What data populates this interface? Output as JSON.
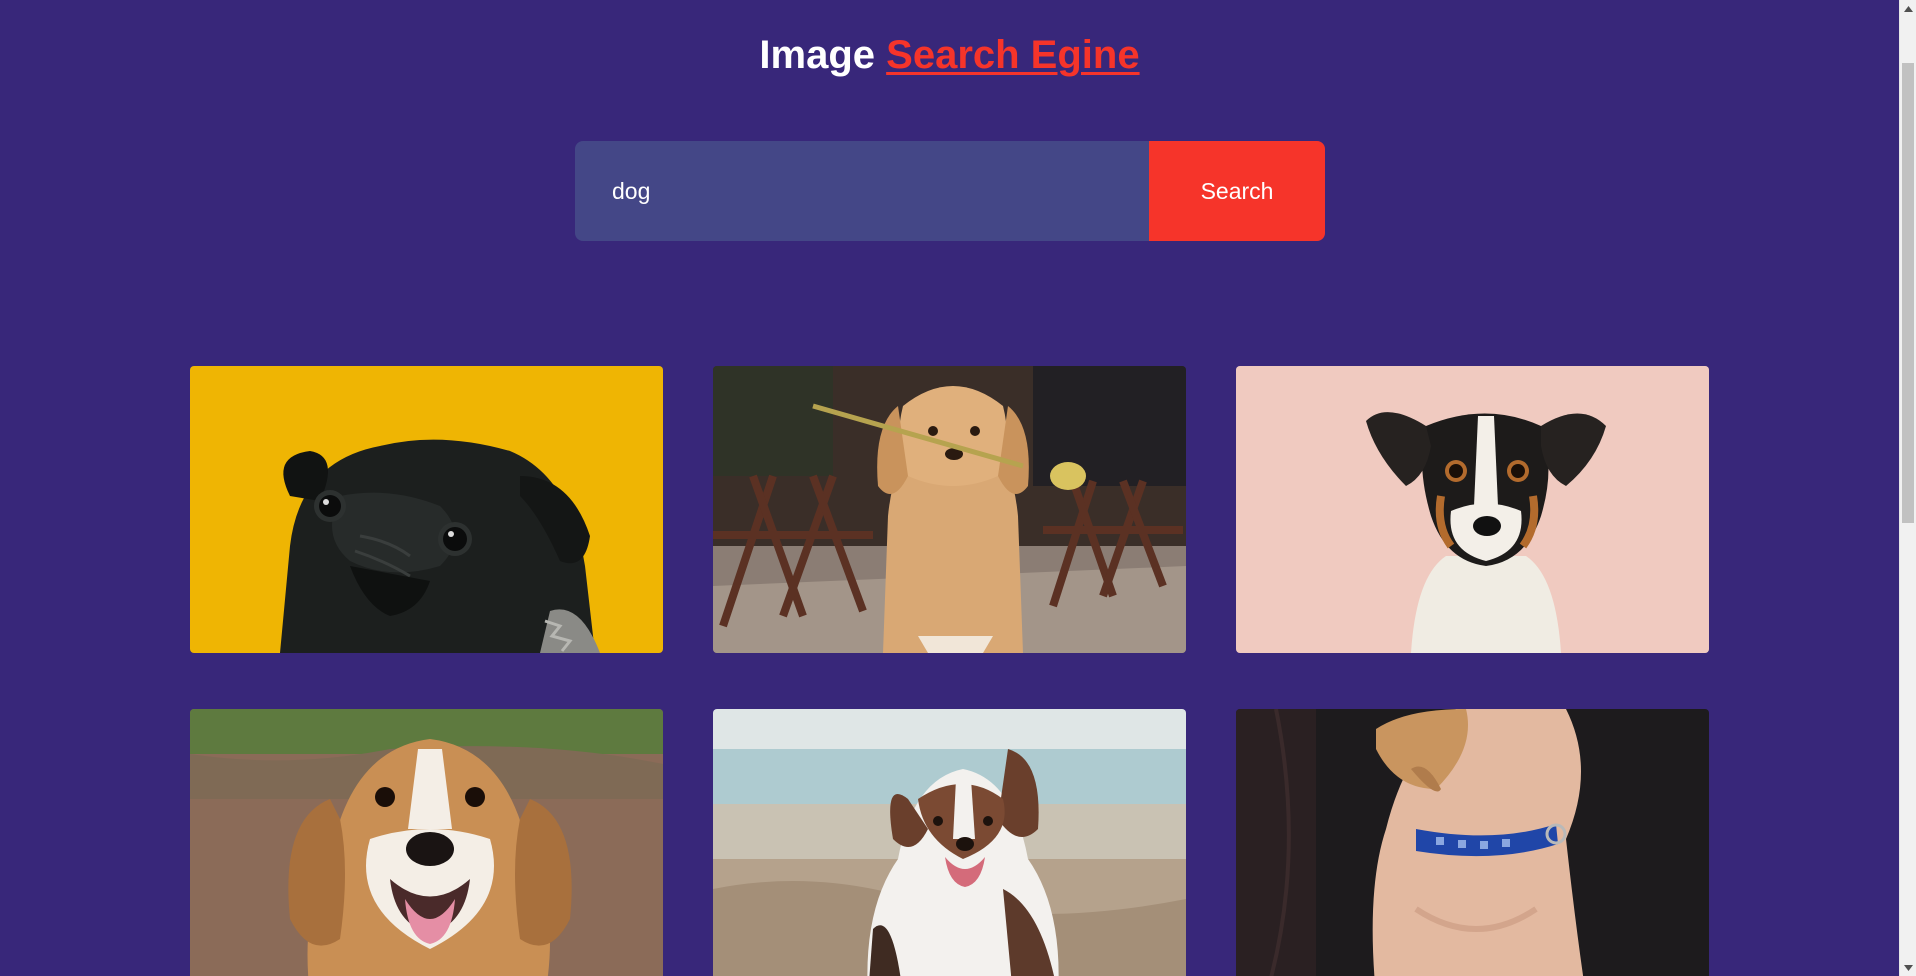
{
  "header": {
    "title_plain": "Image",
    "title_link": "Search Egine"
  },
  "search": {
    "input_value": "dog",
    "button_label": "Search"
  },
  "results": [
    {
      "name": "pug-yellow-background",
      "description": ""
    },
    {
      "name": "golden-retriever-with-flower",
      "description": ""
    },
    {
      "name": "terrier-pink-background",
      "description": ""
    },
    {
      "name": "happy-beagle",
      "description": ""
    },
    {
      "name": "australian-shepherd-beach",
      "description": ""
    },
    {
      "name": "dog-blue-collar",
      "description": ""
    }
  ],
  "colors": {
    "background": "#38277a",
    "accent": "#f6342a",
    "input_bg": "#444787",
    "text": "#ffffff"
  },
  "icons": {
    "scroll_up": "scroll-up-arrow-icon",
    "scroll_down": "scroll-down-arrow-icon"
  }
}
